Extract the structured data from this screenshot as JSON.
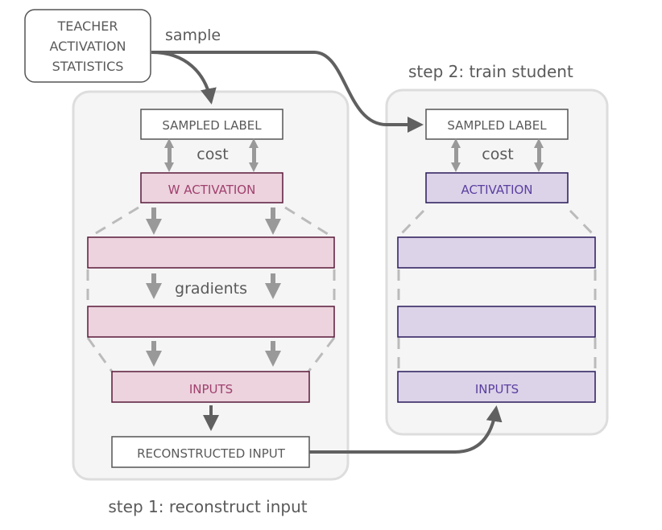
{
  "teacher_box": {
    "lines": [
      "TEACHER",
      "ACTIVATION",
      "STATISTICS"
    ]
  },
  "labels": {
    "sample": "sample",
    "step1": "step 1: reconstruct input",
    "step2": "step 2: train student",
    "cost_left": "cost",
    "cost_right": "cost",
    "gradients": "gradients"
  },
  "left_panel": {
    "sampled_label": "SAMPLED LABEL",
    "activation": "W ACTIVATION",
    "inputs": "INPUTS",
    "reconstructed_input": "RECONSTRUCTED INPUT"
  },
  "right_panel": {
    "sampled_label": "SAMPLED LABEL",
    "activation": "ACTIVATION",
    "inputs": "INPUTS"
  },
  "colors": {
    "panel_bg": "#f5f5f5",
    "panel_border": "#dddddd",
    "pink_fill": "#ecd3dd",
    "pink_border": "#5a1a3a",
    "pink_text": "#a0406e",
    "purple_fill": "#dcd3e8",
    "purple_border": "#2a1a5a",
    "purple_text": "#5a3fa0",
    "arrow_dark": "#606060",
    "arrow_light": "#999999",
    "dash": "#bbbbbb"
  }
}
